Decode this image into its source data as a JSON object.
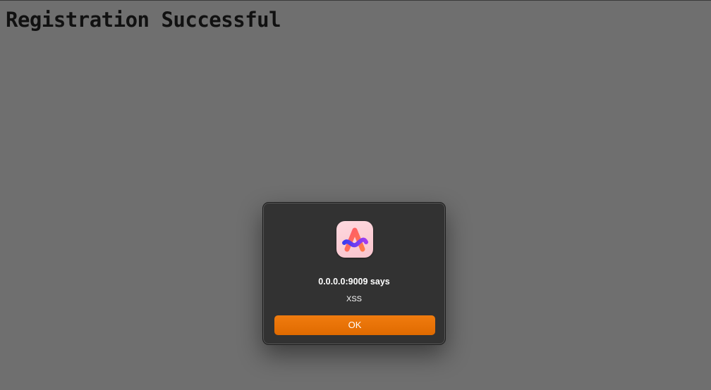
{
  "page": {
    "title": "Registration Successful"
  },
  "alert": {
    "title": "0.0.0.0:9009 says",
    "message": "XSS",
    "ok_label": "OK",
    "icon": "arc-browser-icon"
  },
  "colors": {
    "background": "#6f6f6f",
    "dialog_bg": "#323232",
    "accent": "#ee7604"
  }
}
